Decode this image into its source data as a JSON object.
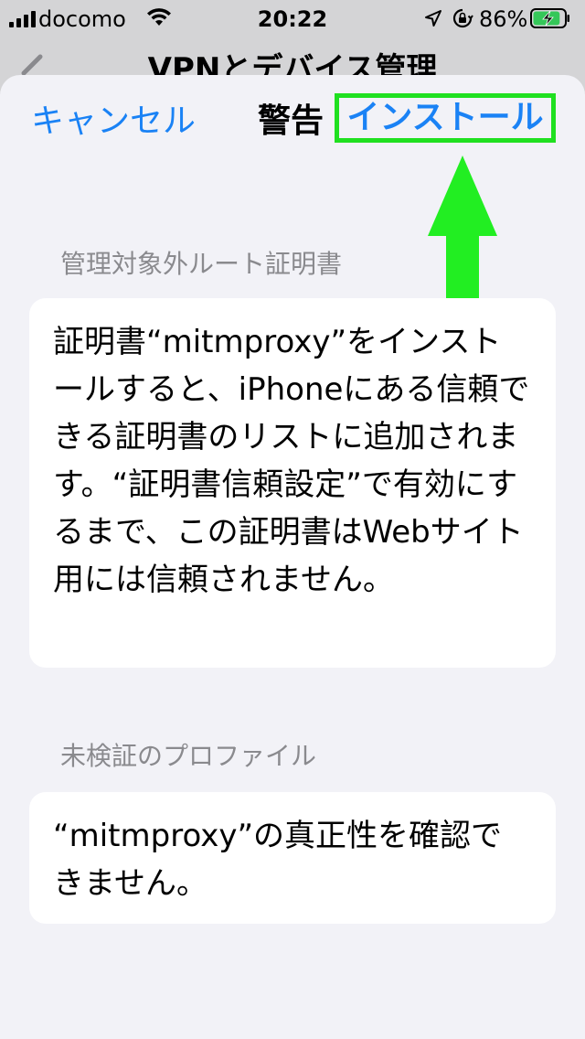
{
  "status_bar": {
    "carrier": "docomo",
    "time": "20:22",
    "battery_percent": "86%",
    "battery_level": 0.86,
    "charging": true,
    "icons": [
      "signal-bars-icon",
      "wifi-icon",
      "location-arrow-icon",
      "rotation-lock-icon",
      "battery-charging-icon"
    ]
  },
  "background_nav": {
    "title": "VPNとデバイス管理"
  },
  "sheet": {
    "nav": {
      "cancel_label": "キャンセル",
      "title": "警告",
      "install_label": "インストール"
    },
    "sections": [
      {
        "header": "管理対象外ルート証明書",
        "body": "証明書“mitmproxy”をインストールすると、iPhoneにある信頼できる証明書のリストに追加されます。“証明書信頼設定”で有効にするまで、この証明書はWebサイト用には信頼されません。"
      },
      {
        "header": "未検証のプロファイル",
        "body": "“mitmproxy”の真正性を確認できません。"
      }
    ]
  },
  "colors": {
    "accent": "#1a82f5",
    "highlight": "#20e020",
    "sheet_bg": "#f2f2f7",
    "section_header": "#8a8a8e"
  }
}
